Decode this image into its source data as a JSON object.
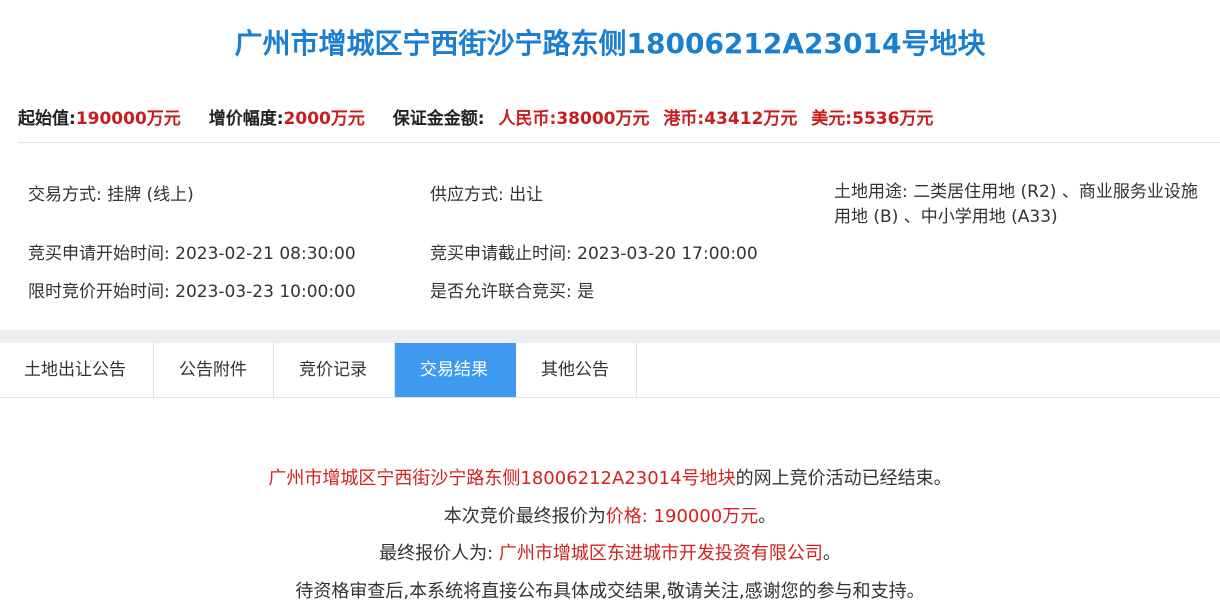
{
  "title": "广州市增城区宁西街沙宁路东侧18006212A23014号地块",
  "pricebar": {
    "start_label": "起始值:",
    "start_value": "190000万元",
    "increment_label": "增价幅度:",
    "increment_value": "2000万元",
    "deposit_label": "保证金金额:",
    "rmb_label": "人民币:",
    "rmb_value": "38000万元",
    "hkd_label": "港币:",
    "hkd_value": "43412万元",
    "usd_label": "美元:",
    "usd_value": "5536万元"
  },
  "info": {
    "trade_method": "交易方式: 挂牌 (线上)",
    "supply_method": "供应方式: 出让",
    "land_use": "土地用途: 二类居住用地 (R2) 、商业服务业设施用地 (B) 、中小学用地 (A33)",
    "apply_start": "竞买申请开始时间: 2023-02-21 08:30:00",
    "apply_end": "竞买申请截止时间: 2023-03-20 17:00:00",
    "bid_start": "限时竞价开始时间: 2023-03-23 10:00:00",
    "joint_bid": "是否允许联合竞买: 是"
  },
  "tabs": [
    {
      "label": "土地出让公告",
      "active": false
    },
    {
      "label": "公告附件",
      "active": false
    },
    {
      "label": "竞价记录",
      "active": false
    },
    {
      "label": "交易结果",
      "active": true
    },
    {
      "label": "其他公告",
      "active": false
    }
  ],
  "result": {
    "line1_parcel": "广州市增城区宁西街沙宁路东侧18006212A23014号地块",
    "line1_suffix": "的网上竞价活动已经结束。",
    "line2_prefix": "本次竞价最终报价为",
    "line2_price": "价格: 190000万元",
    "line2_suffix": "。",
    "line3_prefix": "最终报价人为: ",
    "line3_bidder": "广州市增城区东进城市开发投资有限公司",
    "line3_suffix": "。",
    "line4": "待资格审查后,本系统将直接公布具体成交结果,敬请关注,感谢您的参与和支持。"
  },
  "colors": {
    "title_blue": "#1a7fd0",
    "price_red": "#c81d1d",
    "tab_active_bg": "#3d9af0",
    "result_red": "#d52020"
  }
}
